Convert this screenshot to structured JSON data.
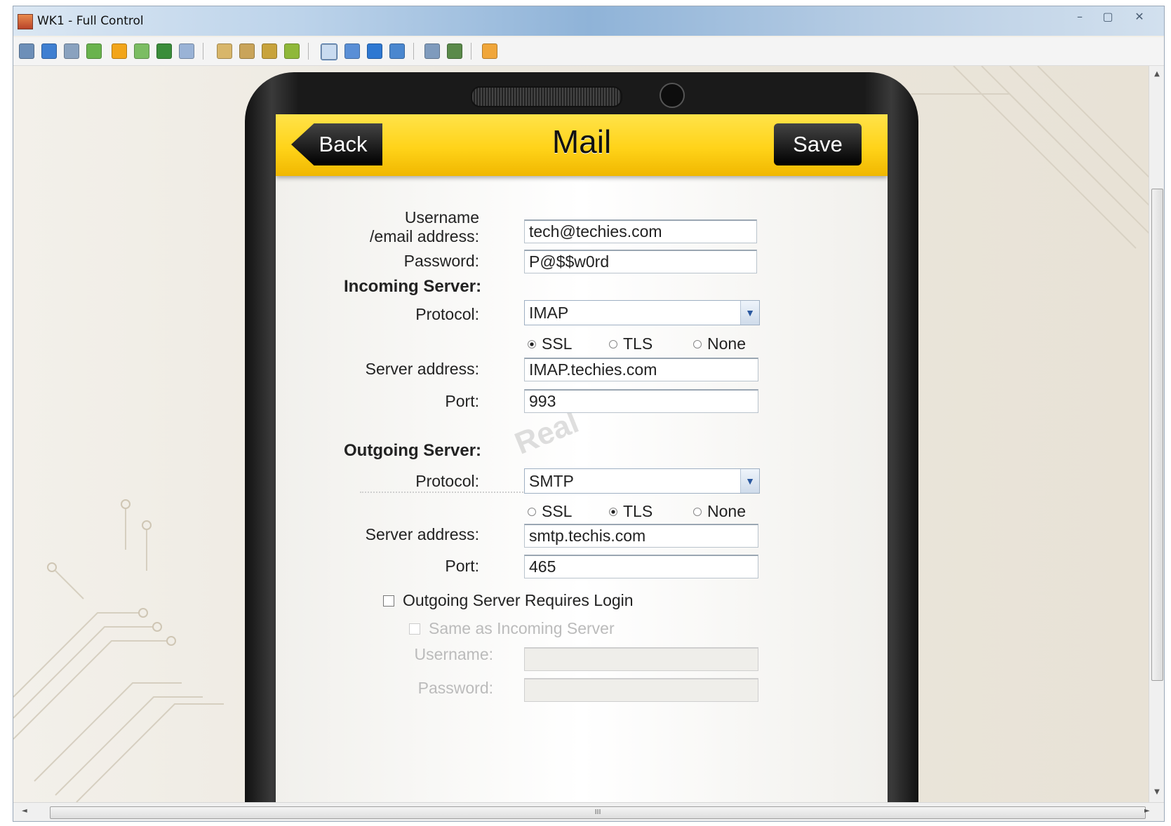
{
  "window": {
    "title": "WK1 - Full Control",
    "minimize": "–",
    "maximize": "▢",
    "close": "✕"
  },
  "toolbar_icons": [
    "save-icon",
    "monitor-icon",
    "terminal-icon",
    "transfer-icon",
    "info-icon",
    "chat-icon",
    "phone-icon",
    "message-icon",
    "user-icon",
    "users-icon",
    "lock-icon",
    "unlock-icon",
    "fullscreen-icon",
    "fit-icon",
    "window-icon",
    "scale-icon",
    "layers-icon",
    "tools-icon",
    "exit-icon"
  ],
  "phone": {
    "header": {
      "back_label": "Back",
      "title": "Mail",
      "save_label": "Save"
    },
    "form": {
      "username_label_1": "Username",
      "username_label_2": "/email address:",
      "username_value": "tech@techies.com",
      "password_label": "Password:",
      "password_value": "P@$$w0rd",
      "incoming_title": "Incoming Server:",
      "incoming_protocol_label": "Protocol:",
      "incoming_protocol_value": "IMAP",
      "incoming_security": [
        "SSL",
        "TLS",
        "None"
      ],
      "incoming_selected": "SSL",
      "incoming_server_label": "Server address:",
      "incoming_server_value": "IMAP.techies.com",
      "incoming_port_label": "Port:",
      "incoming_port_value": "993",
      "outgoing_title": "Outgoing Server:",
      "outgoing_protocol_label": "Protocol:",
      "outgoing_protocol_value": "SMTP",
      "outgoing_security": [
        "SSL",
        "TLS",
        "None"
      ],
      "outgoing_selected": "TLS",
      "outgoing_server_label": "Server address:",
      "outgoing_server_value": "smtp.techis.com",
      "outgoing_port_label": "Port:",
      "outgoing_port_value": "465",
      "requires_login_label": "Outgoing Server Requires Login",
      "same_as_incoming_label": "Same as Incoming Server",
      "login_username_label": "Username:",
      "login_password_label": "Password:"
    },
    "watermark": "Real"
  },
  "scrollbar": {
    "up": "▲",
    "down": "▼",
    "left": "◄",
    "right": "►",
    "grip": "III"
  }
}
